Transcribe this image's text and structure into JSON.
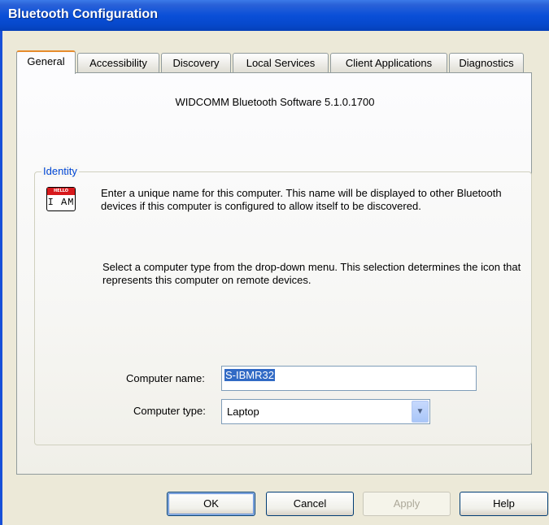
{
  "window": {
    "title": "Bluetooth Configuration"
  },
  "tabs": [
    {
      "label": "General",
      "active": true
    },
    {
      "label": "Accessibility"
    },
    {
      "label": "Discovery"
    },
    {
      "label": "Local Services"
    },
    {
      "label": "Client Applications"
    },
    {
      "label": "Diagnostics"
    }
  ],
  "general": {
    "version_text": "WIDCOMM Bluetooth Software 5.1.0.1700",
    "identity": {
      "group_label": "Identity",
      "icon": "hello-i-am-nametag-icon",
      "icon_text": {
        "top": "HELLO",
        "bottom": "I AM"
      },
      "description1": "Enter a unique name for this computer.  This name will be displayed to other Bluetooth devices if this computer is configured to allow itself to be discovered.",
      "description2": "Select a computer type from the drop-down menu.  This selection determines the icon that represents this computer on remote devices.",
      "computer_name_label": "Computer name:",
      "computer_name_value": "S-IBMR32",
      "computer_type_label": "Computer type:",
      "computer_type_value": "Laptop"
    }
  },
  "buttons": {
    "ok": "OK",
    "cancel": "Cancel",
    "apply": "Apply",
    "help": "Help"
  },
  "colors": {
    "titlebar": "#0a4fd8",
    "group_label": "#0046d5",
    "selection": "#316ac5",
    "active_tab_accent": "#e68b2c"
  }
}
